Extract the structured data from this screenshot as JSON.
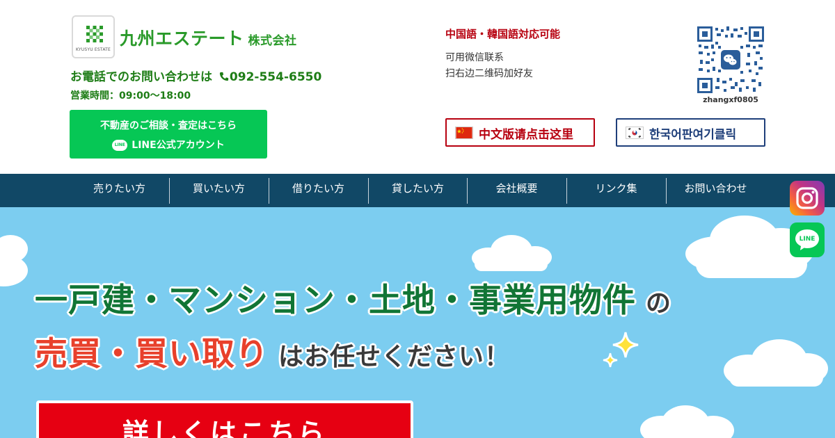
{
  "header": {
    "logo_small_text": "KYUSYU ESTATE",
    "company_name": "九州エステート",
    "company_suffix": "株式会社",
    "phone_label": "お電話でのお問い合わせは",
    "phone_number": "092-554-6550",
    "hours": "営業時間：09:00～18:00",
    "consult_line1": "不動産のご相談・査定はこちら",
    "consult_line2": "LINE公式アカウント",
    "line_badge": "LINE"
  },
  "wechat": {
    "title": "中国語・韓国語対応可能",
    "line1": "可用微信联系",
    "line2": "扫右边二维码加好友",
    "qr_caption": "zhangxf0805"
  },
  "languages": {
    "chinese_label": "中文版请点击这里",
    "korean_label": "한국어판여기클릭"
  },
  "nav": {
    "items": [
      "売りたい方",
      "買いたい方",
      "借りたい方",
      "貸したい方",
      "会社概要",
      "リンク集",
      "お問い合わせ"
    ]
  },
  "social": {
    "line_label": "LINE"
  },
  "hero": {
    "headline1": "一戸建・マンション・土地・事業用物件",
    "headline1_suffix": "の",
    "headline2": "売買・買い取り",
    "headline2_suffix": "はお任せください！",
    "detail_button": "詳しくはこちら"
  },
  "colors": {
    "brand_green": "#2a9a2a",
    "line_green": "#06c755",
    "nav_bg": "#114866",
    "hero_sky": "#7ccdf0",
    "cta_red": "#e60012",
    "chinese_red": "#b7000f",
    "korean_navy": "#1f3f7a"
  }
}
